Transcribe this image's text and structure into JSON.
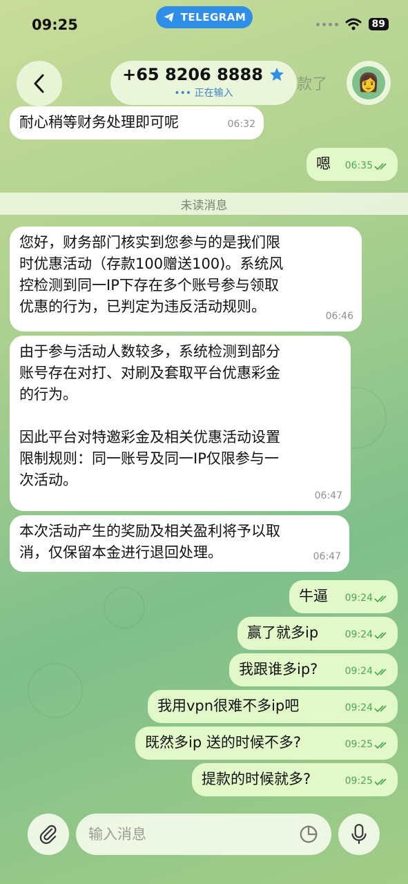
{
  "status": {
    "time": "09:25",
    "app_pill": "TELEGRAM",
    "battery": "89"
  },
  "header": {
    "contact_name": "+65 8206 8888",
    "typing_status": "••• 正在输入",
    "ghost_text": "款了"
  },
  "unread_divider": "未读消息",
  "messages": [
    {
      "dir": "in",
      "text": "耐心稍等财务处理即可呢",
      "time": "06:32"
    },
    {
      "dir": "out",
      "text": "嗯",
      "time": "06:35"
    },
    {
      "dir": "in",
      "text": "您好，财务部门核实到您参与的是我们限\n时优惠活动（存款100赠送100)。系统风\n控检测到同一IP下存在多个账号参与领取\n优惠的行为，已判定为违反活动规则。",
      "time": "06:46"
    },
    {
      "dir": "in",
      "text": "由于参与活动人数较多，系统检测到部分\n账号存在对打、对刷及套取平台优惠彩金\n的行为。\n\n因此平台对特邀彩金及相关优惠活动设置\n限制规则：同一账号及同一IP仅限参与一\n次活动。",
      "time": "06:47"
    },
    {
      "dir": "in",
      "text": "本次活动产生的奖励及相关盈利将予以取\n消，仅保留本金进行退回处理。",
      "time": "06:47"
    },
    {
      "dir": "out",
      "text": "牛逼",
      "time": "09:24"
    },
    {
      "dir": "out",
      "text": "赢了就多ip",
      "time": "09:24"
    },
    {
      "dir": "out",
      "text": "我跟谁多ip?",
      "time": "09:24"
    },
    {
      "dir": "out",
      "text": "我用vpn很难不多ip吧",
      "time": "09:24"
    },
    {
      "dir": "out",
      "text": "既然多ip 送的时候不多?",
      "time": "09:25"
    },
    {
      "dir": "out",
      "text": "提款的时候就多?",
      "time": "09:25"
    }
  ],
  "composer": {
    "placeholder": "输入消息"
  },
  "colors": {
    "accent": "#2f8ee8",
    "outgoing_bubble": "#e2f8c8",
    "incoming_bubble": "#ffffff",
    "read_check": "#4aa94f"
  }
}
